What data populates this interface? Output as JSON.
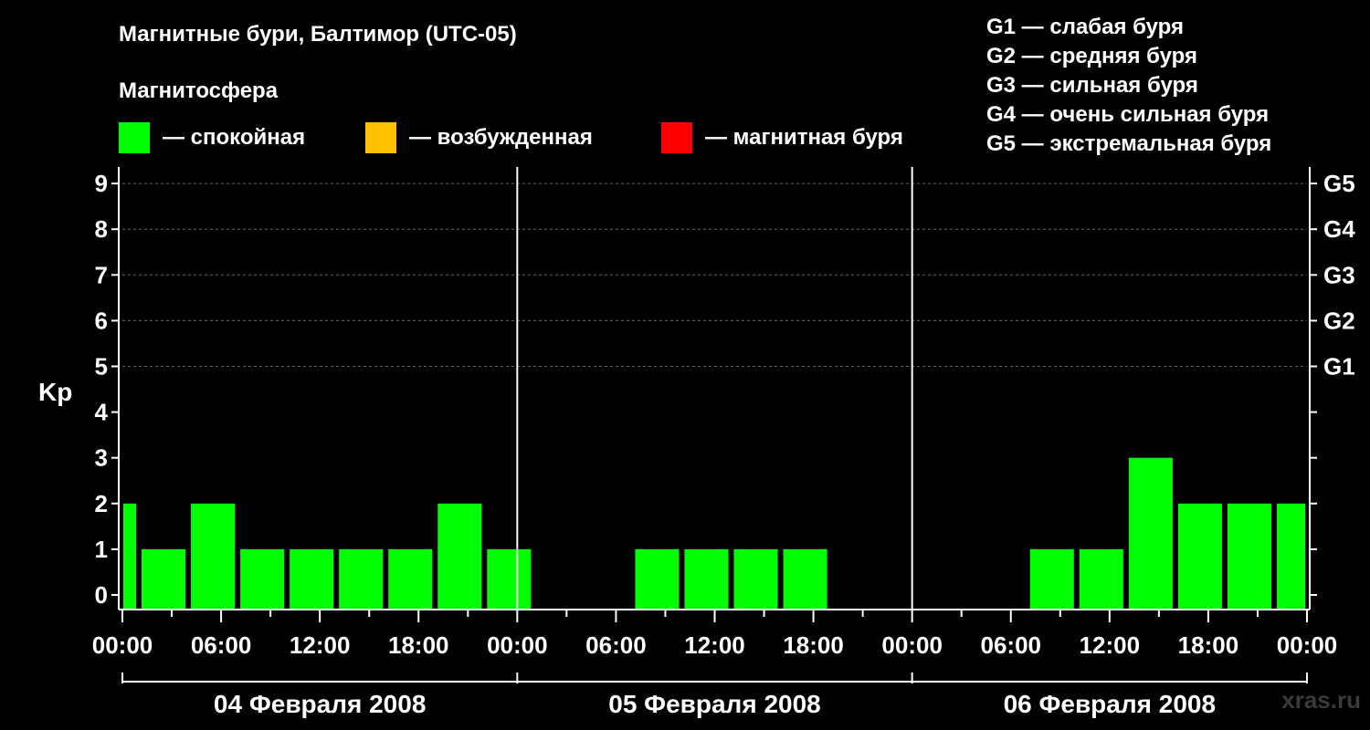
{
  "title": "Магнитные бури, Балтимор (UTC-05)",
  "legend": {
    "heading": "Магнитосфера",
    "items": [
      {
        "label": "— спокойная",
        "color": "#00ff00"
      },
      {
        "label": "— возбужденная",
        "color": "#ffc000"
      },
      {
        "label": "— магнитная буря",
        "color": "#ff0000"
      }
    ]
  },
  "g_scale": [
    "G1 — слабая буря",
    "G2 — средняя буря",
    "G3 — сильная буря",
    "G4 — очень сильная буря",
    "G5 — экстремальная буря"
  ],
  "watermark": "xras.ru",
  "chart_data": {
    "type": "bar",
    "ylabel": "Kp",
    "ylim": [
      0,
      9
    ],
    "y_ticks": [
      "0",
      "1",
      "2",
      "3",
      "4",
      "5",
      "6",
      "7",
      "8",
      "9"
    ],
    "right_ticks": [
      {
        "kp": 5,
        "label": "G1"
      },
      {
        "kp": 6,
        "label": "G2"
      },
      {
        "kp": 7,
        "label": "G3"
      },
      {
        "kp": 8,
        "label": "G4"
      },
      {
        "kp": 9,
        "label": "G5"
      }
    ],
    "x_ticks": [
      "00:00",
      "06:00",
      "12:00",
      "18:00",
      "00:00",
      "06:00",
      "12:00",
      "18:00",
      "00:00",
      "06:00",
      "12:00",
      "18:00",
      "00:00"
    ],
    "days": [
      "04 Февраля 2008",
      "05 Февраля 2008",
      "06 Февраля 2008"
    ],
    "grid": "dashed at Kp 5–9",
    "bars": [
      {
        "start_hour": 0,
        "end_hour": 1,
        "kp": 2
      },
      {
        "start_hour": 1,
        "end_hour": 4,
        "kp": 1
      },
      {
        "start_hour": 4,
        "end_hour": 7,
        "kp": 2
      },
      {
        "start_hour": 7,
        "end_hour": 10,
        "kp": 1
      },
      {
        "start_hour": 10,
        "end_hour": 13,
        "kp": 1
      },
      {
        "start_hour": 13,
        "end_hour": 16,
        "kp": 1
      },
      {
        "start_hour": 16,
        "end_hour": 19,
        "kp": 1
      },
      {
        "start_hour": 19,
        "end_hour": 22,
        "kp": 2
      },
      {
        "start_hour": 22,
        "end_hour": 25,
        "kp": 1
      },
      {
        "start_hour": 25,
        "end_hour": 28,
        "kp": 0
      },
      {
        "start_hour": 28,
        "end_hour": 31,
        "kp": 0
      },
      {
        "start_hour": 31,
        "end_hour": 34,
        "kp": 1
      },
      {
        "start_hour": 34,
        "end_hour": 37,
        "kp": 1
      },
      {
        "start_hour": 37,
        "end_hour": 40,
        "kp": 1
      },
      {
        "start_hour": 40,
        "end_hour": 43,
        "kp": 1
      },
      {
        "start_hour": 43,
        "end_hour": 46,
        "kp": 0
      },
      {
        "start_hour": 46,
        "end_hour": 49,
        "kp": 0
      },
      {
        "start_hour": 49,
        "end_hour": 52,
        "kp": 0
      },
      {
        "start_hour": 52,
        "end_hour": 55,
        "kp": 0
      },
      {
        "start_hour": 55,
        "end_hour": 58,
        "kp": 1
      },
      {
        "start_hour": 58,
        "end_hour": 61,
        "kp": 1
      },
      {
        "start_hour": 61,
        "end_hour": 64,
        "kp": 3
      },
      {
        "start_hour": 64,
        "end_hour": 67,
        "kp": 2
      },
      {
        "start_hour": 67,
        "end_hour": 70,
        "kp": 2
      },
      {
        "start_hour": 70,
        "end_hour": 72,
        "kp": 2
      }
    ],
    "colors": {
      "quiet": "#00ff00",
      "active": "#ffc000",
      "storm": "#ff0000"
    }
  }
}
